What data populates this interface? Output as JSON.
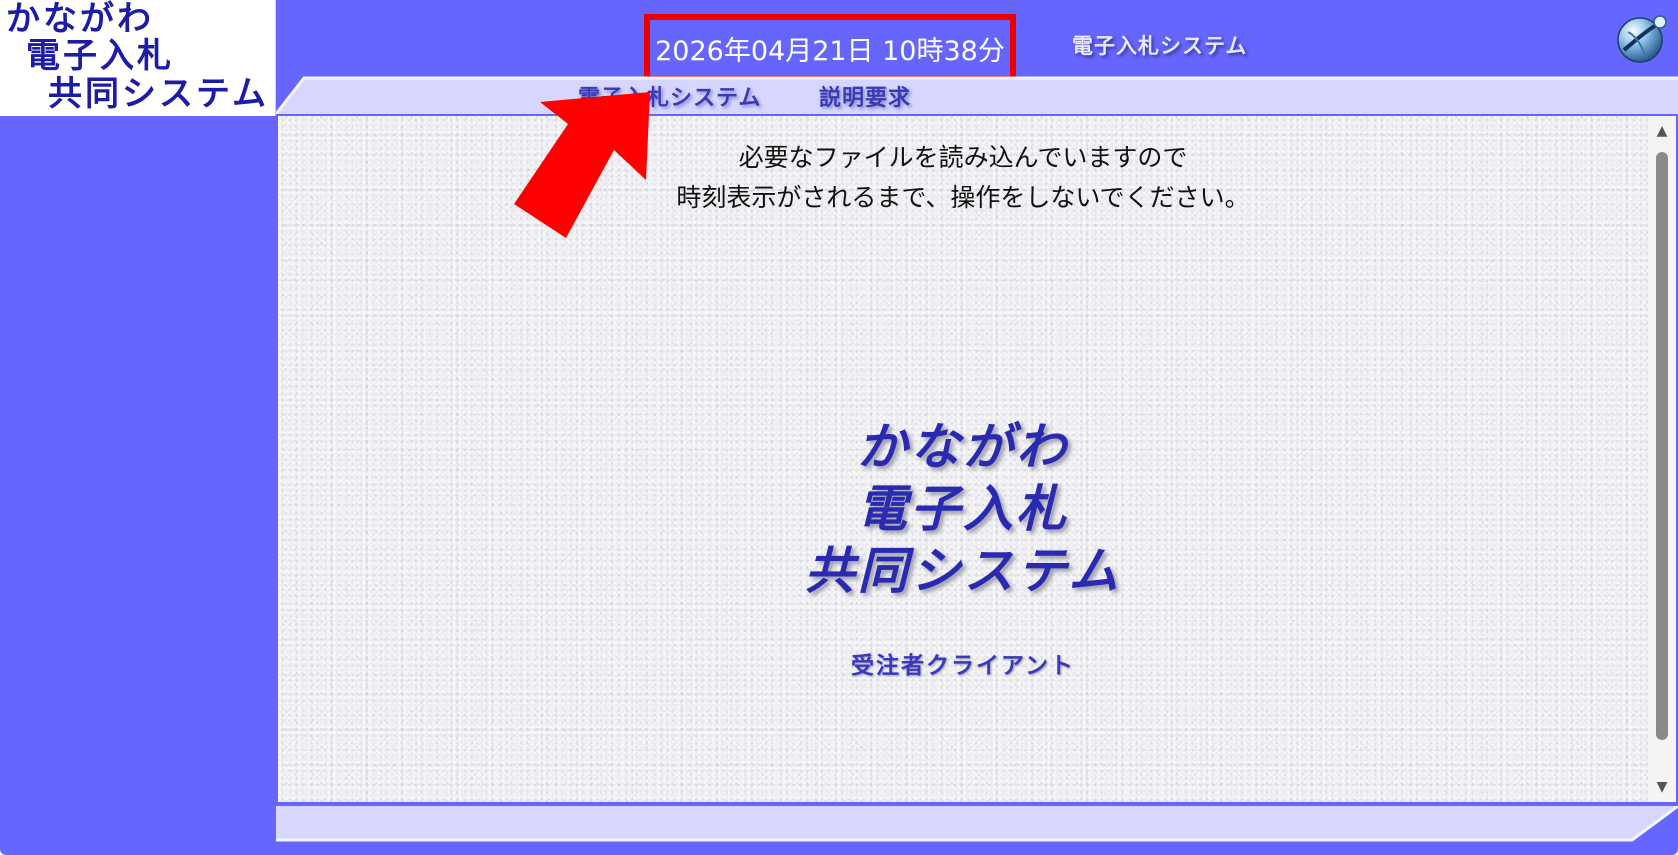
{
  "logo": {
    "line1": "かながわ",
    "line2": "電子入札",
    "line3": "共同システム"
  },
  "header": {
    "datetime": "2026年04月21日 10時38分",
    "title": "電子入札システム",
    "icon": "globe-icon"
  },
  "tabs": [
    {
      "label": "電子入札システム"
    },
    {
      "label": "説明要求"
    }
  ],
  "main": {
    "message_line1": "必要なファイルを読み込んでいますので",
    "message_line2": "時刻表示がされるまで、操作をしないでください。",
    "splash_line1": "かながわ",
    "splash_line2": "電子入札",
    "splash_line3": "共同システム",
    "client_label": "受注者クライアント"
  },
  "scrollbar": {
    "up": "▲",
    "down": "▼"
  },
  "colors": {
    "frame": "#6666ff",
    "logo_text": "#1c1ca8",
    "highlight_box": "#ee0000",
    "arrow": "#ff0000",
    "content_bg": "#eeeef2"
  }
}
